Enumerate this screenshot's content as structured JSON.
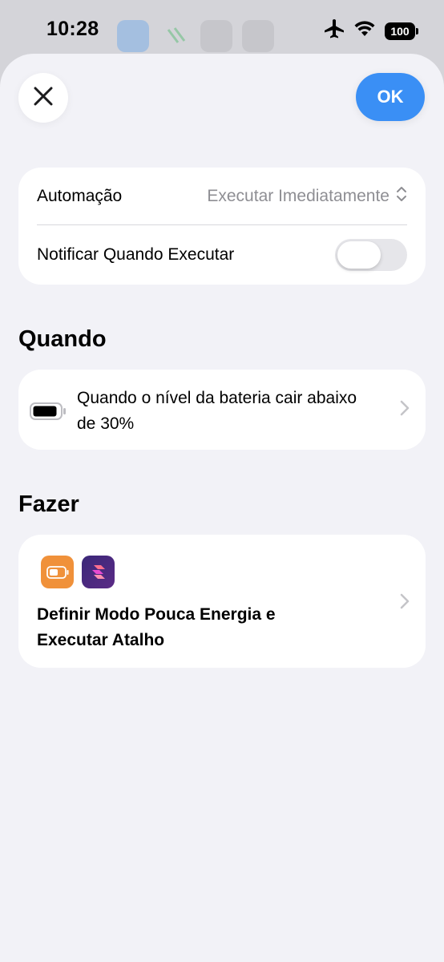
{
  "status_bar": {
    "time": "10:28",
    "battery_level": "100",
    "icons": [
      "airplane-icon",
      "wifi-icon",
      "battery-icon"
    ]
  },
  "header": {
    "close_icon": "close-icon",
    "ok_label": "OK"
  },
  "settings": {
    "automation_label": "Automação",
    "automation_value": "Executar Imediatamente",
    "notify_label": "Notificar Quando Executar",
    "notify_enabled": false
  },
  "when": {
    "title": "Quando",
    "trigger_text": "Quando o nível da bateria cair abaixo de 30%",
    "icon": "battery-icon"
  },
  "do": {
    "title": "Fazer",
    "action_text": "Definir Modo Pouca Energia e Executar Atalho",
    "icons": [
      "low-power-mode-icon",
      "shortcuts-app-icon"
    ]
  },
  "colors": {
    "accent": "#3a8ff5",
    "background": "#f2f2f7",
    "card": "#ffffff",
    "secondary_text": "#8e8e93",
    "low_power_orange": "#f0913a",
    "shortcuts_purple": "#5b2a86"
  }
}
